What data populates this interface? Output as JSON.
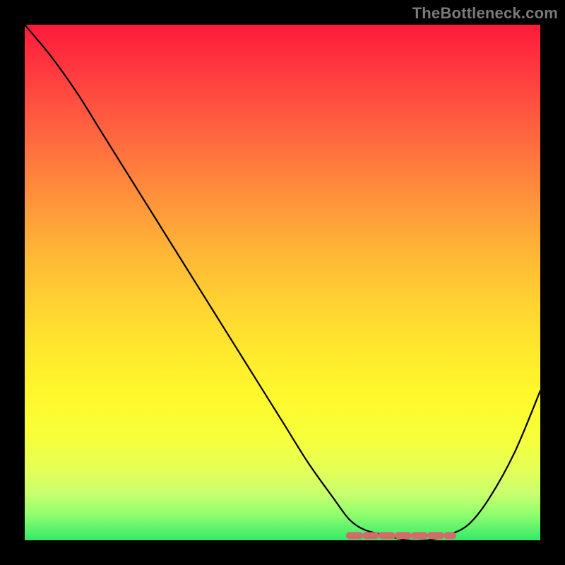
{
  "watermark": "TheBottleneck.com",
  "colors": {
    "curve": "#000000",
    "highlight": "#d56a6a",
    "gradient_top": "#ff1a3c",
    "gradient_bottom": "#34e96a"
  },
  "chart_data": {
    "type": "line",
    "title": "",
    "xlabel": "",
    "ylabel": "",
    "xlim": [
      0,
      100
    ],
    "ylim": [
      0,
      100
    ],
    "series": [
      {
        "name": "bottleneck-curve",
        "x": [
          0,
          5,
          10,
          15,
          20,
          25,
          30,
          35,
          40,
          45,
          50,
          55,
          60,
          63,
          66,
          70,
          74,
          78,
          82,
          86,
          90,
          95,
          100
        ],
        "y": [
          100,
          94,
          87,
          79,
          71,
          63,
          55,
          47,
          39,
          31,
          23,
          15,
          8,
          4,
          2,
          1,
          0,
          0,
          1,
          3,
          8,
          17,
          29
        ]
      }
    ],
    "flat_region": {
      "x_start": 63,
      "x_end": 83,
      "y": 0.9
    },
    "grid": false,
    "legend": false
  }
}
